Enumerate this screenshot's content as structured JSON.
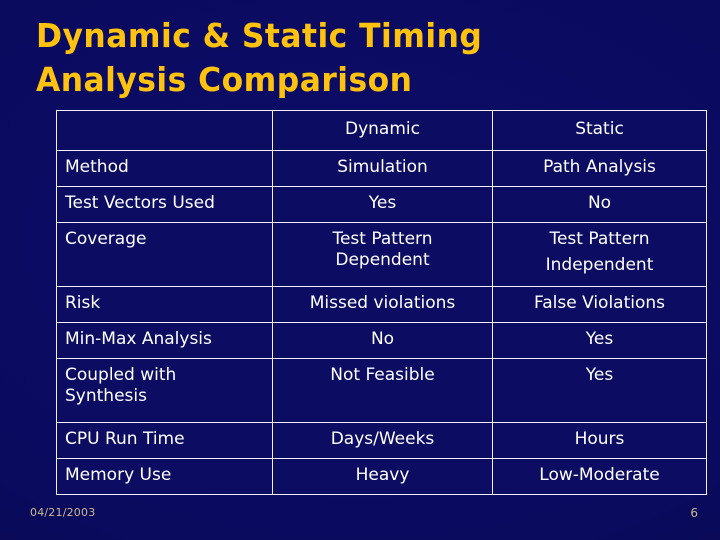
{
  "slide": {
    "title_lines": [
      "Dynamic & Static Timing",
      "Analysis Comparison"
    ],
    "title_color": "#ffc20e",
    "background_color": "#0a0a5e",
    "text_color": "#ffffff",
    "border_color": "#f2f2f2"
  },
  "table": {
    "headers": [
      "",
      "Dynamic",
      "Static"
    ],
    "rows": [
      {
        "label": "Method",
        "dynamic": [
          "Simulation"
        ],
        "static": [
          "Path Analysis"
        ]
      },
      {
        "label": "Test Vectors Used",
        "dynamic": [
          "Yes"
        ],
        "static": [
          "No"
        ]
      },
      {
        "label": "Coverage",
        "dynamic": [
          "Test Pattern",
          "Dependent"
        ],
        "static": [
          "Test Pattern",
          "Independent"
        ]
      },
      {
        "label": "Risk",
        "dynamic": [
          "Missed violations"
        ],
        "static": [
          "False Violations"
        ]
      },
      {
        "label": "Min-Max Analysis",
        "dynamic": [
          "No"
        ],
        "static": [
          "Yes"
        ]
      },
      {
        "label_lines": [
          "Coupled with",
          "Synthesis"
        ],
        "label": "Coupled with Synthesis",
        "dynamic": [
          "Not Feasible"
        ],
        "static": [
          "Yes"
        ]
      },
      {
        "label": "CPU Run Time",
        "dynamic": [
          "Days/Weeks"
        ],
        "static": [
          "Hours"
        ]
      },
      {
        "label": "Memory Use",
        "dynamic": [
          "Heavy"
        ],
        "static": [
          "Low-Moderate"
        ]
      }
    ]
  },
  "footer": {
    "date": "04/21/2003",
    "page_number": "6",
    "color": "#c9b98c"
  }
}
